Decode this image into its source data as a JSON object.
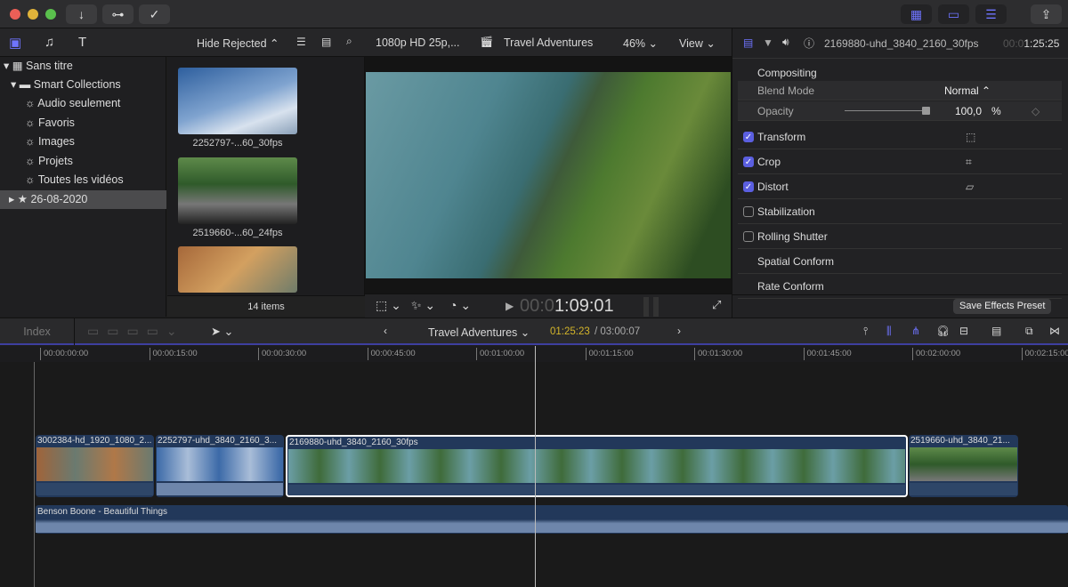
{
  "titlebar": {
    "buttons": [
      "↓",
      "⊶",
      "✓"
    ],
    "right_icons": [
      "grid-icon",
      "filmstrip-icon",
      "sliders-icon",
      "share-icon"
    ]
  },
  "browser": {
    "filter": "Hide Rejected",
    "items_count": "14 items",
    "library": "Sans titre",
    "smart_collections": "Smart Collections",
    "collections": [
      "Audio seulement",
      "Favoris",
      "Images",
      "Projets",
      "Toutes les vidéos"
    ],
    "event": "26-08-2020",
    "clips": [
      "2252797-...60_30fps",
      "2519660-...60_24fps"
    ]
  },
  "viewer": {
    "format": "1080p HD 25p,...",
    "project": "Travel Adventures",
    "zoom": "46%",
    "view": "View",
    "timecode_dim": "00:0",
    "timecode": "1:09:01"
  },
  "inspector": {
    "clip_name": "2169880-uhd_3840_2160_30fps",
    "timecode_dim": "00:0",
    "timecode": "1:25:25",
    "compositing": "Compositing",
    "blend_mode_label": "Blend Mode",
    "blend_mode": "Normal",
    "opacity_label": "Opacity",
    "opacity": "100,0",
    "opacity_unit": "%",
    "opacity_value": 100,
    "sections": [
      {
        "label": "Transform",
        "checked": true
      },
      {
        "label": "Crop",
        "checked": true
      },
      {
        "label": "Distort",
        "checked": true
      },
      {
        "label": "Stabilization",
        "checked": false
      },
      {
        "label": "Rolling Shutter",
        "checked": false
      },
      {
        "label": "Spatial Conform",
        "checked": null
      },
      {
        "label": "Rate Conform",
        "checked": null
      }
    ],
    "save_preset": "Save Effects Preset"
  },
  "timeline": {
    "index": "Index",
    "project": "Travel Adventures",
    "position": "01:25:23",
    "duration": "/ 03:00:07",
    "ruler": [
      "00:00:00:00",
      "00:00:15:00",
      "00:00:30:00",
      "00:00:45:00",
      "00:01:00:00",
      "00:01:15:00",
      "00:01:30:00",
      "00:01:45:00",
      "00:02:00:00",
      "00:02:15:00"
    ],
    "clips": [
      "3002384-hd_1920_1080_2...",
      "2252797-uhd_3840_2160_3...",
      "2169880-uhd_3840_2160_30fps",
      "2519660-uhd_3840_21..."
    ],
    "audio": "Benson Boone - Beautiful Things"
  },
  "colors": {
    "accent": "#5b5fe0",
    "timecode_yellow": "#d4b52a"
  }
}
